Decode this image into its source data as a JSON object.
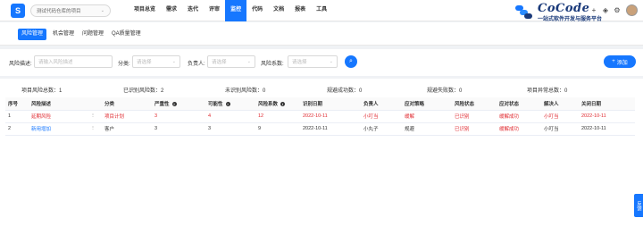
{
  "header": {
    "logo_icon": "app-logo-icon",
    "project": "测试代码仓库的项目",
    "nav": [
      {
        "label": "项目总览",
        "active": false
      },
      {
        "label": "需求",
        "active": false
      },
      {
        "label": "迭代",
        "active": false
      },
      {
        "label": "评审",
        "active": false
      },
      {
        "label": "监控",
        "active": true
      },
      {
        "label": "代码",
        "active": false
      },
      {
        "label": "文档",
        "active": false
      },
      {
        "label": "报表",
        "active": false
      },
      {
        "label": "工具",
        "active": false
      }
    ],
    "brand_name": "CoCode",
    "brand_sub": "一站式软件开发与服务平台",
    "icons": [
      "plus-icon",
      "layers-icon",
      "settings-icon",
      "avatar"
    ]
  },
  "tabs": [
    {
      "label": "风险管理",
      "active": true
    },
    {
      "label": "机会管理",
      "active": false
    },
    {
      "label": "问题管理",
      "active": false
    },
    {
      "label": "QA质量管理",
      "active": false
    }
  ],
  "filters": {
    "desc_label": "风险描述:",
    "desc_placeholder": "请输入风险描述",
    "category_label": "分类:",
    "category_placeholder": "请选择",
    "owner_label": "负责人:",
    "owner_placeholder": "请选择",
    "coef_label": "风险系数:",
    "coef_placeholder": "请选择",
    "add_label": "添加"
  },
  "stats": [
    {
      "label": "项目风险总数：",
      "value": "1"
    },
    {
      "label": "已识别风险数：",
      "value": "2"
    },
    {
      "label": "未识别风险数：",
      "value": "0"
    },
    {
      "label": "规避成功数：",
      "value": "0"
    },
    {
      "label": "规避失败数：",
      "value": "0"
    },
    {
      "label": "项目异常总数：",
      "value": "0"
    }
  ],
  "table": {
    "headers": [
      "序号",
      "风险描述",
      "",
      "分类",
      "严重性",
      "可能性",
      "风险系数",
      "识别日期",
      "负责人",
      "应对策略",
      "风险状态",
      "应对状态",
      "解决人",
      "关闭日期"
    ],
    "rows": [
      {
        "cells": [
          "1",
          "延期风险",
          "⋮",
          "项目计划",
          "3",
          "4",
          "12",
          "2022-10-11",
          "小叮当",
          "缓解",
          "已识别",
          "缓解成功",
          "小叮当",
          "2022-10-11"
        ],
        "highlight": true
      },
      {
        "cells": [
          "2",
          "新用增加",
          "⋮",
          "客户",
          "3",
          "3",
          "9",
          "2022-10-11",
          "小丸子",
          "规避",
          "已识别",
          "缓解成功",
          "小叮当",
          "2022-10-11"
        ],
        "highlight": false
      }
    ]
  },
  "side_tab": "反馈",
  "colors": {
    "accent": "#1677ff",
    "danger": "#e0282e"
  }
}
